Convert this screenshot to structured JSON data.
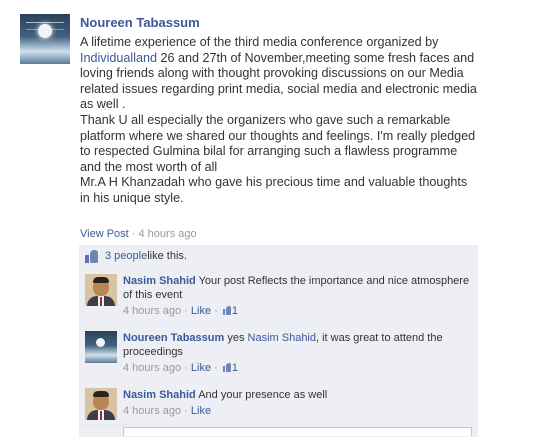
{
  "post": {
    "author": "Noureen Tabassum",
    "body_before_link": "A lifetime experience of the third media conference organized by ",
    "body_link": "Individualland",
    "body_after_link": " 26 and 27th of November,meeting some fresh faces and loving friends along with thought provoking discussions on our Media related issues regarding print media, social media and electronic media as well .\nThank U all especially the organizers who gave such a remarkable platform where we shared our thoughts and feelings. I'm really pledged to respected Gulmina bilal for arranging such a flawless programme and the most worth of all\nMr.A H Khanzadah who gave his precious time and valuable thoughts in his unique style.",
    "view_post_label": "View Post",
    "separator": " · ",
    "time": "4 hours ago"
  },
  "likes": {
    "count_text": "3 people",
    "suffix": " like this."
  },
  "comments": [
    {
      "author": "Nasim Shahid",
      "text": " Your post Reflects the importance and nice atmosphere of this event",
      "time": "4 hours ago",
      "like_label": "Like",
      "like_count": "1",
      "avatar": "man-portrait"
    },
    {
      "author": "Noureen Tabassum",
      "text_before": " yes ",
      "mention": "Nasim Shahid",
      "text_after": ", it was great to attend the proceedings",
      "time": "4 hours ago",
      "like_label": "Like",
      "like_count": "1",
      "avatar": "night-sky"
    },
    {
      "author": "Nasim Shahid",
      "text": " And your presence as well",
      "time": "4 hours ago",
      "like_label": "Like",
      "avatar": "man-portrait"
    }
  ],
  "colors": {
    "link": "#3b5998",
    "ufi_bg": "#edeff4",
    "meta": "#999999"
  },
  "icons": {
    "like": "thumbs-up-icon"
  }
}
